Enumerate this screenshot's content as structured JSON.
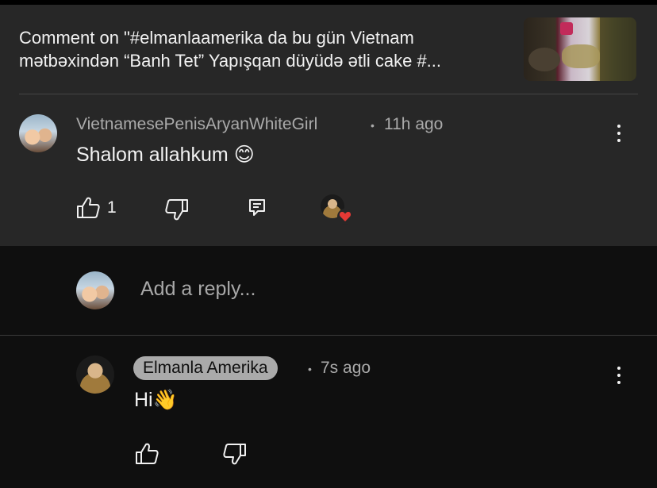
{
  "header": {
    "title": "Comment on \"#elmanlaamerika da bu gün Vietnam\nmətbəxindən “Banh Tet” Yapışqan düyüdə ətli cake #..."
  },
  "comment": {
    "author": "VietnamesePenisAryanWhiteGirl",
    "separator": "•",
    "time": "11h ago",
    "text": "Shalom allahkum 😊",
    "like_count": "1"
  },
  "reply_box": {
    "placeholder": "Add a reply..."
  },
  "reply": {
    "author": "Elmanla Amerika",
    "separator": "•",
    "time": "7s ago",
    "text": "Hi👋"
  },
  "icons": [
    "thumbs-up-icon",
    "thumbs-down-icon",
    "reply-icon",
    "more-vert-icon",
    "heart-icon"
  ],
  "colors": {
    "panel": "#272727",
    "background": "#0f0f0f",
    "heart": "#e53935",
    "owner_badge": "#aaaaaa"
  }
}
